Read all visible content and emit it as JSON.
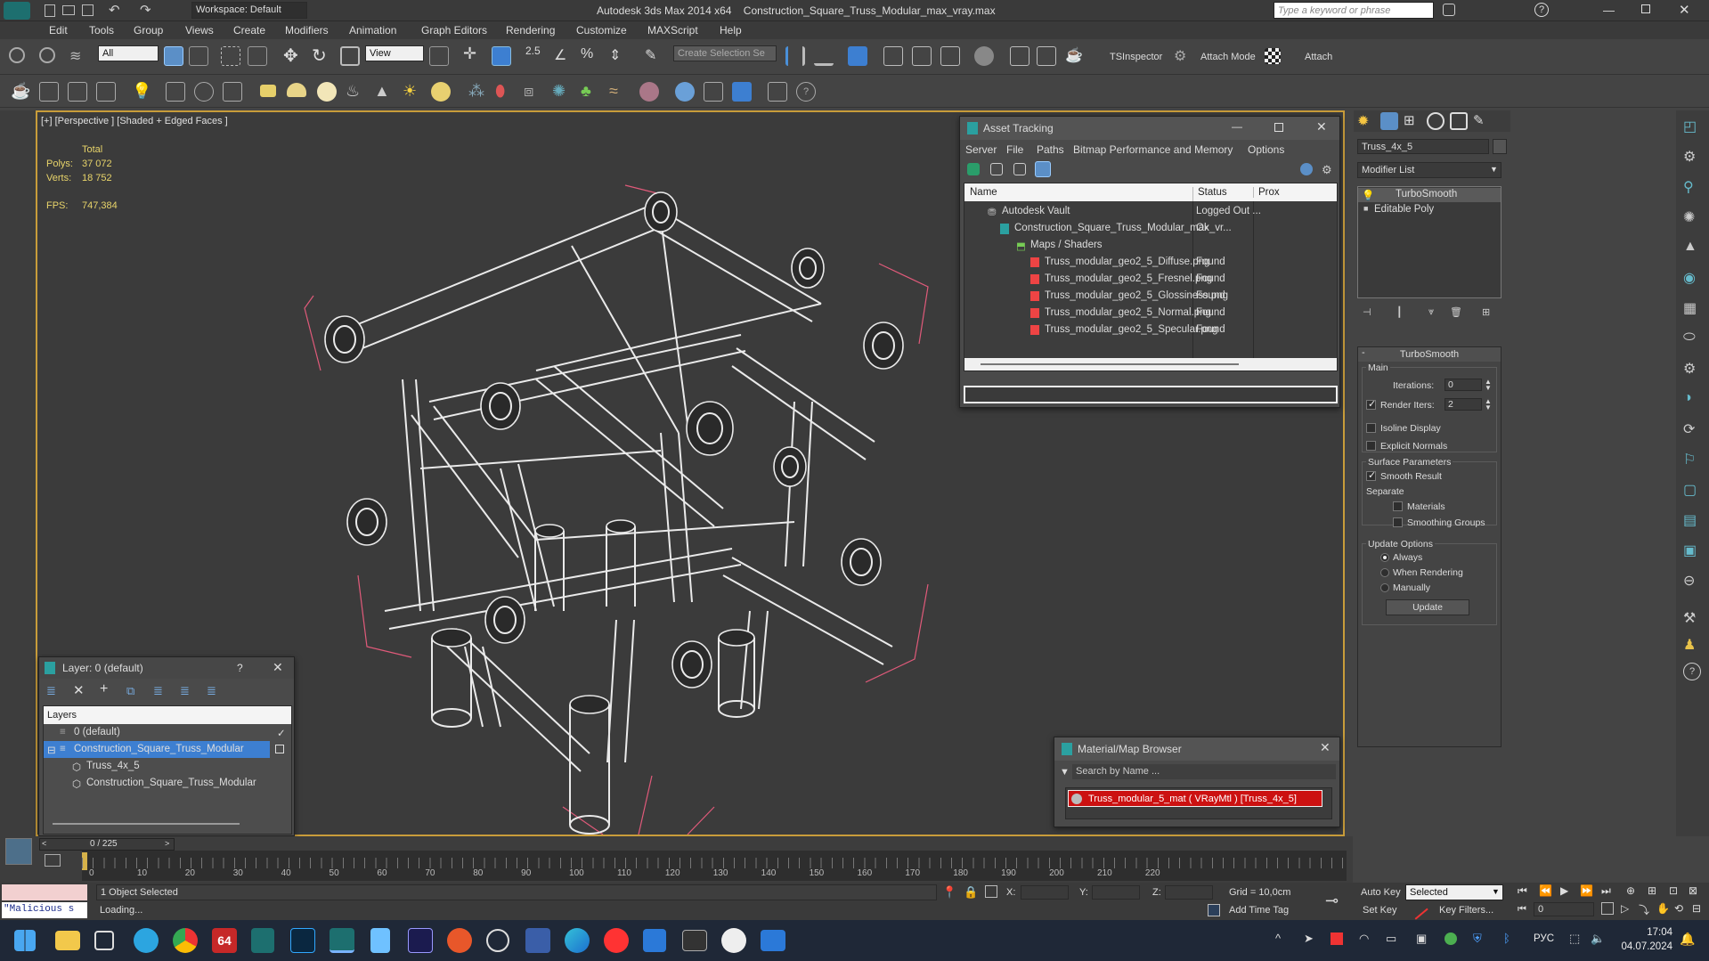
{
  "app": {
    "title": "Autodesk 3ds Max  2014 x64",
    "file": "Construction_Square_Truss_Modular_max_vray.max",
    "workspace": "Workspace: Default",
    "search_placeholder": "Type a keyword or phrase"
  },
  "menu": [
    "Edit",
    "Tools",
    "Group",
    "Views",
    "Create",
    "Modifiers",
    "Animation",
    "Graph Editors",
    "Rendering",
    "Customize",
    "MAXScript",
    "Help"
  ],
  "toolbar": {
    "filter": "All",
    "refcoord": "View",
    "snap_value": "2.5",
    "selection_set": "Create Selection Se",
    "tsinspector": "TSInspector",
    "attach_mode": "Attach Mode",
    "attach": "Attach"
  },
  "viewport": {
    "label": "[+] [Perspective ] [Shaded + Edged Faces ]",
    "stats": {
      "total_label": "Total",
      "polys_label": "Polys:",
      "polys": "37 072",
      "verts_label": "Verts:",
      "verts": "18 752",
      "fps_label": "FPS:",
      "fps": "747,384"
    }
  },
  "asset_tracking": {
    "title": "Asset Tracking",
    "menu": [
      "Server",
      "File",
      "Paths",
      "Bitmap Performance and Memory",
      "Options"
    ],
    "columns": [
      "Name",
      "Status",
      "Prox"
    ],
    "rows": [
      {
        "name": "Autodesk Vault",
        "status": "Logged Out ..."
      },
      {
        "name": "Construction_Square_Truss_Modular_max_vr...",
        "status": "Ok"
      },
      {
        "name": "Maps / Shaders",
        "status": ""
      },
      {
        "name": "Truss_modular_geo2_5_Diffuse.png",
        "status": "Found"
      },
      {
        "name": "Truss_modular_geo2_5_Fresnel.png",
        "status": "Found"
      },
      {
        "name": "Truss_modular_geo2_5_Glossiness.png",
        "status": "Found"
      },
      {
        "name": "Truss_modular_geo2_5_Normal.png",
        "status": "Found"
      },
      {
        "name": "Truss_modular_geo2_5_Specular.png",
        "status": "Found"
      }
    ]
  },
  "layer_panel": {
    "title": "Layer: 0 (default)",
    "help": "?",
    "header": "Layers",
    "items": [
      {
        "label": "0 (default)"
      },
      {
        "label": "Construction_Square_Truss_Modular"
      },
      {
        "label": "Truss_4x_5"
      },
      {
        "label": "Construction_Square_Truss_Modular"
      }
    ]
  },
  "material_browser": {
    "title": "Material/Map Browser",
    "search_placeholder": "Search by Name ...",
    "item": "Truss_modular_5_mat  ( VRayMtl )  [Truss_4x_5]"
  },
  "command_panel": {
    "object_name": "Truss_4x_5",
    "modifier_list": "Modifier List",
    "stack": [
      "TurboSmooth",
      "Editable Poly"
    ],
    "rollout_title": "TurboSmooth",
    "main_label": "Main",
    "iterations_label": "Iterations:",
    "iterations": "0",
    "render_iters_label": "Render Iters:",
    "render_iters": "2",
    "isoline": "Isoline Display",
    "explicit_normals": "Explicit Normals",
    "surface_params": "Surface Parameters",
    "smooth_result": "Smooth Result",
    "separate": "Separate",
    "materials": "Materials",
    "smoothing_groups": "Smoothing Groups",
    "update_options": "Update Options",
    "always": "Always",
    "when_rendering": "When Rendering",
    "manually": "Manually",
    "update_button": "Update"
  },
  "timeline": {
    "frame": "0 / 225",
    "ticks": [
      "0",
      "10",
      "20",
      "30",
      "40",
      "50",
      "60",
      "70",
      "80",
      "90",
      "100",
      "110",
      "120",
      "130",
      "140",
      "150",
      "160",
      "170",
      "180",
      "190",
      "200",
      "210",
      "220"
    ]
  },
  "status": {
    "selected": "1 Object Selected",
    "loading": "Loading...",
    "script": "\"Malicious s",
    "x_label": "X:",
    "y_label": "Y:",
    "z_label": "Z:",
    "grid": "Grid = 10,0cm",
    "add_time_tag": "Add Time Tag",
    "auto_key": "Auto Key",
    "auto_key_mode": "Selected",
    "set_key": "Set Key",
    "key_filters": "Key Filters...",
    "frame": "0"
  },
  "taskbar": {
    "lang": "РУС",
    "time": "17:04",
    "date": "04.07.2024",
    "badge": "64"
  }
}
